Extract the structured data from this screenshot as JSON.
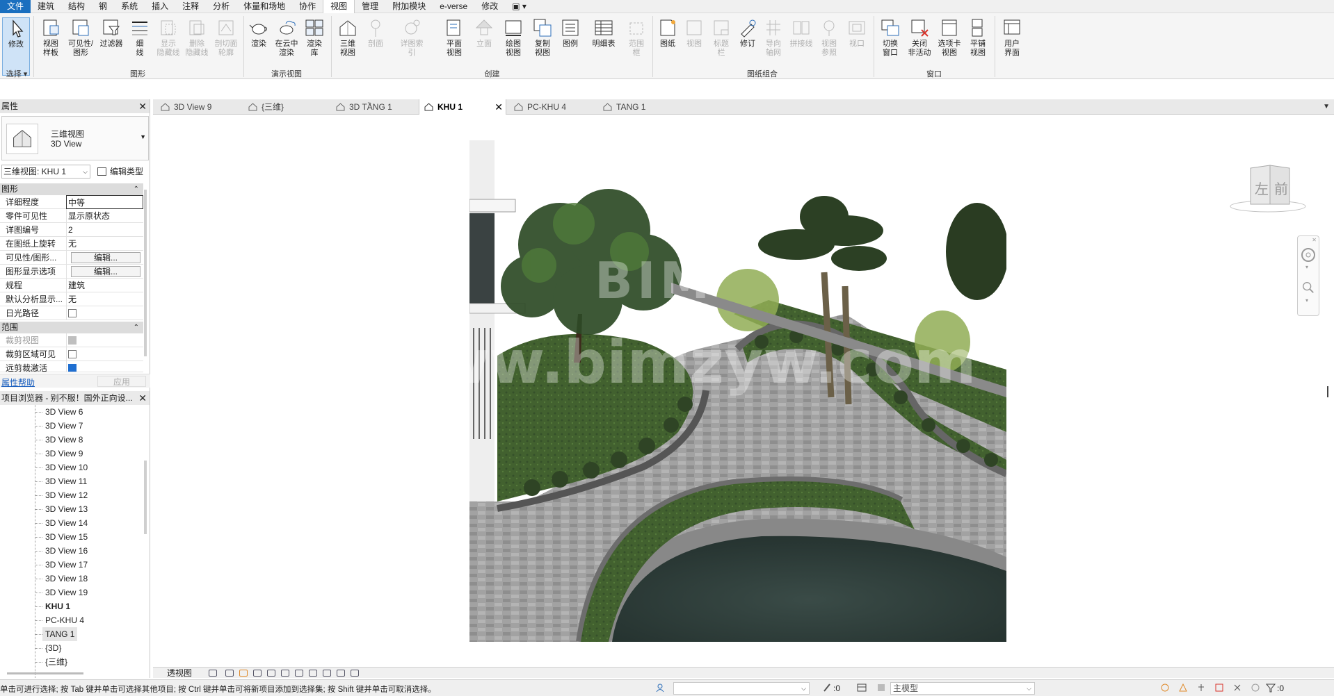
{
  "menubar": {
    "items": [
      "文件",
      "建筑",
      "结构",
      "钢",
      "系统",
      "插入",
      "注释",
      "分析",
      "体量和场地",
      "协作",
      "视图",
      "管理",
      "附加模块",
      "e-verse",
      "修改",
      "▣ ▾"
    ]
  },
  "ribbon": {
    "select": {
      "modify": "修改",
      "select": "选择 ▾"
    },
    "graphics": {
      "label": "图形",
      "buttons": [
        "视图\n样板",
        "可见性/\n图形",
        "过滤器",
        "细\n线",
        "显示\n隐藏线",
        "删除\n隐藏线",
        "剖切面\n轮廓"
      ]
    },
    "presentation": {
      "label": "演示视图",
      "buttons": [
        "渲染",
        "在云中\n渲染",
        "渲染\n库"
      ]
    },
    "create": {
      "label": "创建",
      "buttons": [
        "三维\n视图",
        "剖面",
        "详图索引",
        "平面\n视图",
        "立面",
        "绘图\n视图",
        "复制\n视图",
        "图例",
        "明细表",
        "范围\n框"
      ]
    },
    "sheets": {
      "label": "图纸组合",
      "buttons": [
        "图纸",
        "视图",
        "标题\n栏",
        "修订",
        "导向\n轴网",
        "拼接线",
        "视图\n参照",
        "视口"
      ]
    },
    "windows": {
      "label": "窗口",
      "buttons": [
        "切换\n窗口",
        "关闭\n非活动",
        "选项卡\n视图",
        "平铺\n视图"
      ]
    },
    "ui": {
      "buttons": [
        "用户\n界面"
      ]
    }
  },
  "tabs": [
    {
      "label": "3D View 9"
    },
    {
      "label": "{三维}"
    },
    {
      "label": "3D TẦNG 1"
    },
    {
      "label": "KHU 1",
      "active": true
    },
    {
      "label": "PC-KHU 4"
    },
    {
      "label": "TANG 1"
    }
  ],
  "properties": {
    "title": "属性",
    "type_cn": "三维视图",
    "type_en": "3D View",
    "instance": "三维视图: KHU 1",
    "edit_type": "编辑类型",
    "section_graphics": "图形",
    "rows_graphics": [
      {
        "k": "详细程度",
        "v": "中等"
      },
      {
        "k": "零件可见性",
        "v": "显示原状态"
      },
      {
        "k": "详图编号",
        "v": "2"
      },
      {
        "k": "在图纸上旋转",
        "v": "无"
      },
      {
        "k": "可见性/图形...",
        "v": "编辑..."
      },
      {
        "k": "图形显示选项",
        "v": "编辑..."
      },
      {
        "k": "规程",
        "v": "建筑"
      },
      {
        "k": "默认分析显示...",
        "v": "无"
      },
      {
        "k": "日光路径",
        "v": ""
      }
    ],
    "section_extents": "范围",
    "rows_extents": [
      {
        "k": "裁剪视图",
        "v": ""
      },
      {
        "k": "裁剪区域可见",
        "v": ""
      },
      {
        "k": "远剪裁激活",
        "v": ""
      }
    ],
    "help": "属性帮助",
    "apply": "应用"
  },
  "browser": {
    "title": "项目浏览器 - 别不服！国外正向设...",
    "items": [
      "3D View 6",
      "3D View 7",
      "3D View 8",
      "3D View 9",
      "3D View 10",
      "3D View 11",
      "3D View 12",
      "3D View 13",
      "3D View 14",
      "3D View 15",
      "3D View 16",
      "3D View 17",
      "3D View 18",
      "3D View 19",
      "KHU 1",
      "PC-KHU 4",
      "TANG 1",
      "{3D}",
      "{三维}"
    ]
  },
  "viewcube": {
    "left": "左",
    "front": "前"
  },
  "watermark": {
    "line1": "BIM",
    "line2": "www.bimzyw.com"
  },
  "viewbar": {
    "scale": "透视图"
  },
  "status": {
    "message": "单击可进行选择; 按 Tab 键并单击可选择其他项目; 按 Ctrl 键并单击可将新项目添加到选择集; 按 Shift 键并单击可取消选择。",
    "count1": ":0",
    "model": "主模型",
    "filter_count": ":0"
  },
  "colors": {
    "accent": "#1a6fbf",
    "grass": "#3e5a2c",
    "paving": "#9a9a9a",
    "water": "#2f3d3a"
  }
}
